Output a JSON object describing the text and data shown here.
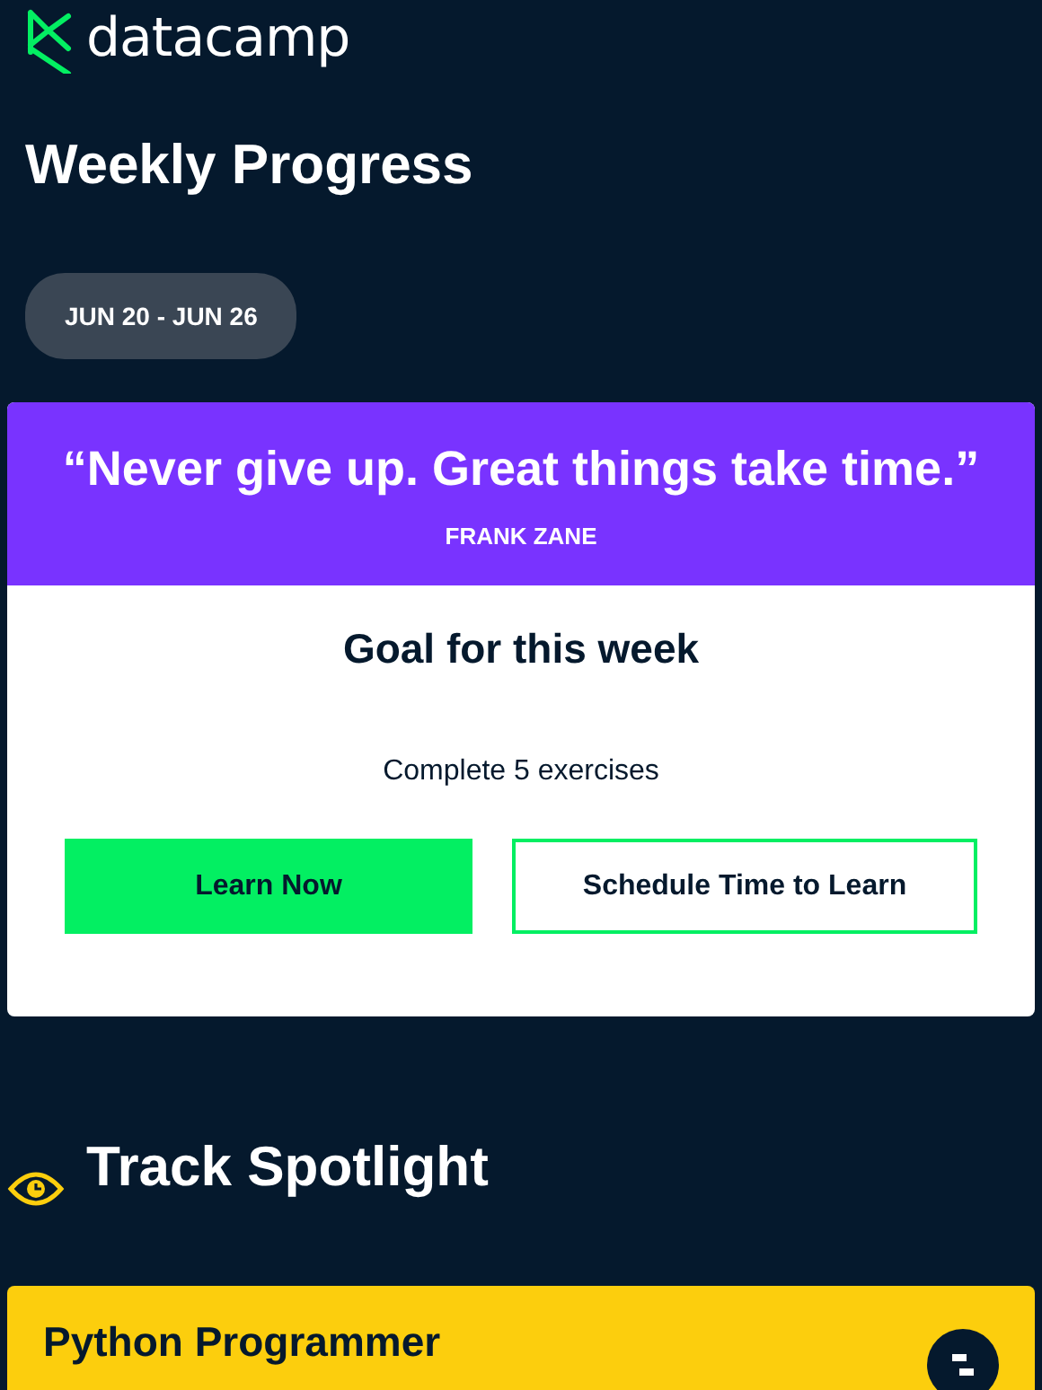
{
  "brand": {
    "name": "datacamp"
  },
  "page_title": "Weekly Progress",
  "date_range": "JUN 20 - JUN 26",
  "quote": {
    "text": "“Never give up. Great things take time.”",
    "author": "FRANK ZANE"
  },
  "goal": {
    "title": "Goal for this week",
    "description": "Complete 5 exercises",
    "buttons": [
      {
        "label": "Learn Now",
        "kind": "primary"
      },
      {
        "label": "Schedule Time to Learn",
        "kind": "outline"
      }
    ]
  },
  "spotlight": {
    "title": "Track Spotlight",
    "track_title": "Python Programmer"
  }
}
